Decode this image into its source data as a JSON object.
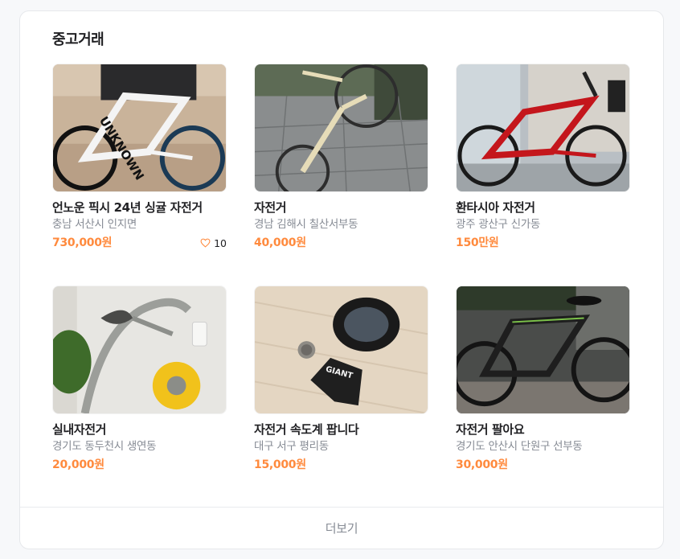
{
  "section": {
    "title": "중고거래",
    "more_label": "더보기"
  },
  "colors": {
    "price": "#ff8a3d",
    "region": "#868b94"
  },
  "items": [
    {
      "title": "언노운 픽시 24년 싱귤 자전거",
      "region": "충남 서산시 인지면",
      "price": "730,000원",
      "likes": "10",
      "icon": "heart-icon"
    },
    {
      "title": "자전거",
      "region": "경남 김해시 칠산서부동",
      "price": "40,000원"
    },
    {
      "title": "환타시아 자전거",
      "region": "광주 광산구 신가동",
      "price": "150만원"
    },
    {
      "title": "실내자전거",
      "region": "경기도 동두천시 생연동",
      "price": "20,000원"
    },
    {
      "title": "자전거 속도계 팝니다",
      "region": "대구 서구 평리동",
      "price": "15,000원"
    },
    {
      "title": "자전거 팔아요",
      "region": "경기도 안산시 단원구 선부동",
      "price": "30,000원"
    }
  ]
}
